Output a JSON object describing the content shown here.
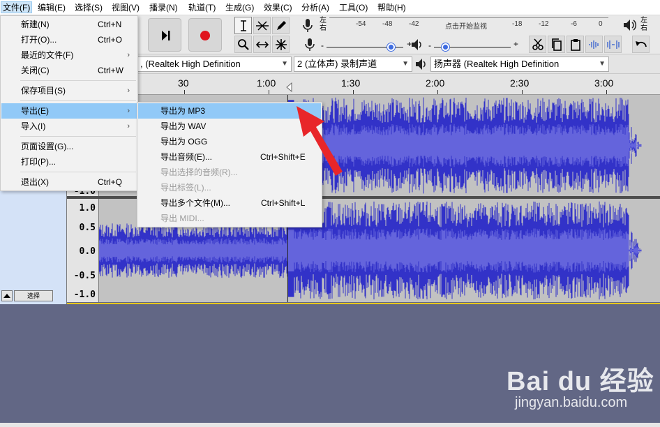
{
  "menubar": {
    "items": [
      {
        "label": "文件(F)"
      },
      {
        "label": "编辑(E)"
      },
      {
        "label": "选择(S)"
      },
      {
        "label": "视图(V)"
      },
      {
        "label": "播录(N)"
      },
      {
        "label": "轨道(T)"
      },
      {
        "label": "生成(G)"
      },
      {
        "label": "效果(C)"
      },
      {
        "label": "分析(A)"
      },
      {
        "label": "工具(O)"
      },
      {
        "label": "帮助(H)"
      }
    ]
  },
  "meters": {
    "rec_lr": "左\n右",
    "rec_scale": [
      "-54",
      "-48",
      "-42",
      "点击开始监视",
      "-18",
      "-12",
      "-6",
      "0"
    ],
    "play_lr": "左\n右"
  },
  "devices": {
    "host_partial": ", (Realtek High Definition",
    "channels": "2 (立体声) 录制声道",
    "output": "扬声器 (Realtek High Definition"
  },
  "timeline": {
    "ticks": [
      "30",
      "1:00",
      "1:30",
      "2:00",
      "2:30",
      "3:00"
    ]
  },
  "track": {
    "ruler_top": [
      "1.0"
    ],
    "ruler_bottom_prev": "-1.0",
    "ruler_ch2": [
      "1.0",
      "0.5",
      "0.0",
      "-0.5",
      "-1.0"
    ],
    "select_label": "选择"
  },
  "file_menu": {
    "items": [
      {
        "label": "新建(N)",
        "shortcut": "Ctrl+N",
        "sub": ""
      },
      {
        "label": "打开(O)...",
        "shortcut": "Ctrl+O",
        "sub": ""
      },
      {
        "label": "最近的文件(F)",
        "shortcut": "",
        "sub": "›"
      },
      {
        "label": "关闭(C)",
        "shortcut": "Ctrl+W",
        "sub": ""
      },
      {
        "label": "保存项目(S)",
        "shortcut": "",
        "sub": "›"
      },
      {
        "label": "导出(E)",
        "shortcut": "",
        "sub": "›"
      },
      {
        "label": "导入(I)",
        "shortcut": "",
        "sub": "›"
      },
      {
        "label": "页面设置(G)...",
        "shortcut": "",
        "sub": ""
      },
      {
        "label": "打印(P)...",
        "shortcut": "",
        "sub": ""
      },
      {
        "label": "退出(X)",
        "shortcut": "Ctrl+Q",
        "sub": ""
      }
    ]
  },
  "export_menu": {
    "items": [
      {
        "label": "导出为 MP3",
        "shortcut": "",
        "enabled": true
      },
      {
        "label": "导出为 WAV",
        "shortcut": "",
        "enabled": true
      },
      {
        "label": "导出为 OGG",
        "shortcut": "",
        "enabled": true
      },
      {
        "label": "导出音频(E)...",
        "shortcut": "Ctrl+Shift+E",
        "enabled": true
      },
      {
        "label": "导出选择的音频(R)...",
        "shortcut": "",
        "enabled": false
      },
      {
        "label": "导出标签(L)...",
        "shortcut": "",
        "enabled": false
      },
      {
        "label": "导出多个文件(M)...",
        "shortcut": "Ctrl+Shift+L",
        "enabled": true
      },
      {
        "label": "导出 MIDI...",
        "shortcut": "",
        "enabled": false
      }
    ]
  },
  "watermark": {
    "logo": "Bai du 经验",
    "url": "jingyan.baidu.com"
  },
  "colors": {
    "wave_fill": "#3232c8",
    "wave_rms": "#6464dc",
    "highlight": "#91c9f7",
    "annotation_arrow": "#e8262a",
    "background": "#626785"
  },
  "icons": {
    "transport": [
      "skip-end-icon",
      "record-icon"
    ],
    "tools": [
      "selection-tool-icon",
      "envelope-tool-icon",
      "draw-tool-icon",
      "zoom-tool-icon",
      "timeshift-tool-icon",
      "multi-tool-icon"
    ],
    "edit": [
      "cut-icon",
      "copy-icon",
      "paste-icon",
      "trim-icon",
      "silence-icon",
      "undo-icon"
    ]
  }
}
